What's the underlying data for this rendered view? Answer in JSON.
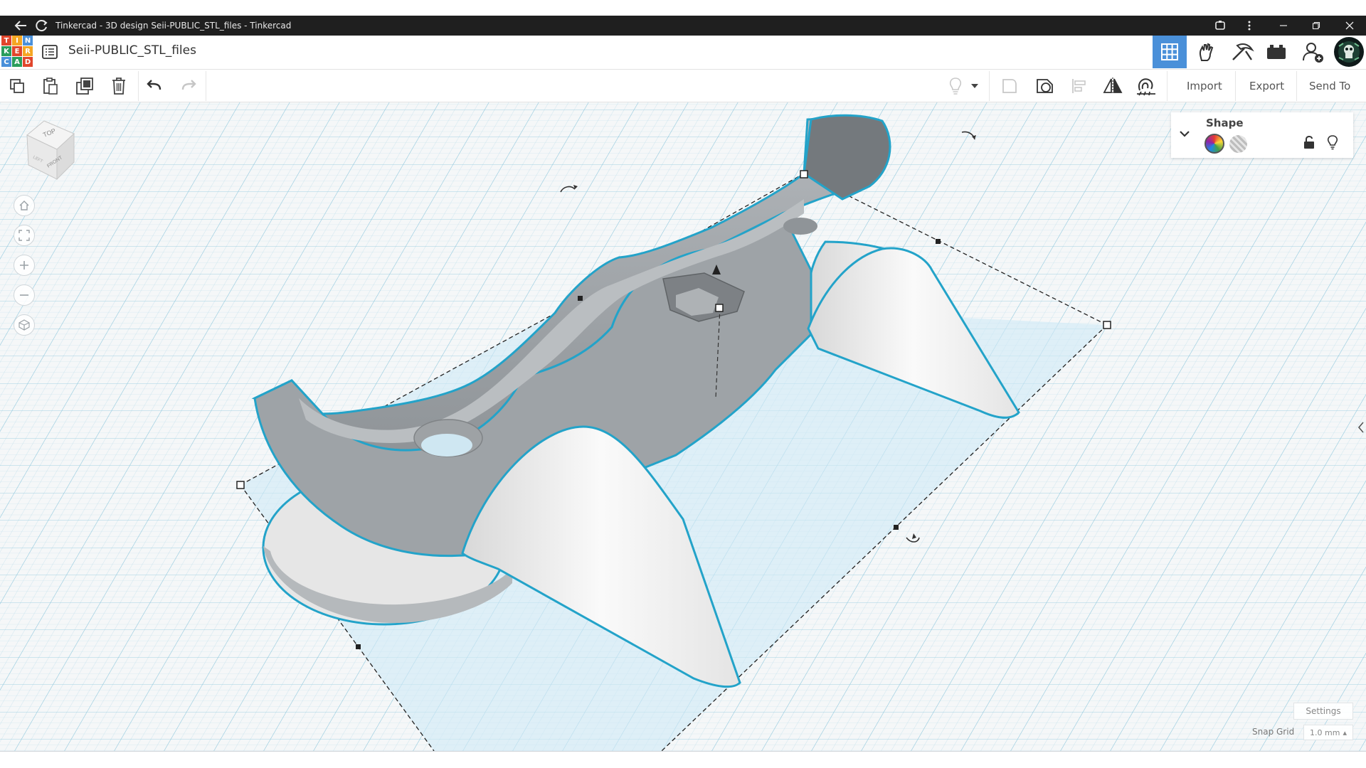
{
  "window": {
    "title": "Tinkercad - 3D design Seii-PUBLIC_STL_files - Tinkercad"
  },
  "app": {
    "logo_letters": [
      "T",
      "I",
      "N",
      "K",
      "E",
      "R",
      "C",
      "A",
      "D"
    ],
    "logo_colors": [
      "#e1462c",
      "#f5a623",
      "#4a90d9",
      "#2a9d5c",
      "#e1462c",
      "#f5a623",
      "#4a90d9",
      "#2a9d5c",
      "#e1462c"
    ],
    "design_name": "Seii-PUBLIC_STL_files"
  },
  "header_buttons": [
    {
      "name": "3d-design-view-icon",
      "active": true
    },
    {
      "name": "blocks-icon",
      "active": false
    },
    {
      "name": "bricks-icon",
      "active": false
    },
    {
      "name": "sim-lab-icon",
      "active": false
    },
    {
      "name": "add-user-icon",
      "active": false
    },
    {
      "name": "profile-avatar",
      "active": false
    }
  ],
  "toolbar": {
    "import_label": "Import",
    "export_label": "Export",
    "send_to_label": "Send To"
  },
  "viewcube": {
    "top": "TOP",
    "front": "FRONT",
    "left": "LEFT"
  },
  "shape_panel": {
    "title": "Shape"
  },
  "footer": {
    "settings_label": "Settings",
    "snap_grid_label": "Snap Grid",
    "snap_grid_value": "1.0 mm",
    "snap_arrow": "▴"
  },
  "colors": {
    "accent": "#4a90d9",
    "selection_outline": "#23a3c9",
    "shape_gray": "#a9aeb2",
    "shape_white": "#f3f3f3"
  }
}
